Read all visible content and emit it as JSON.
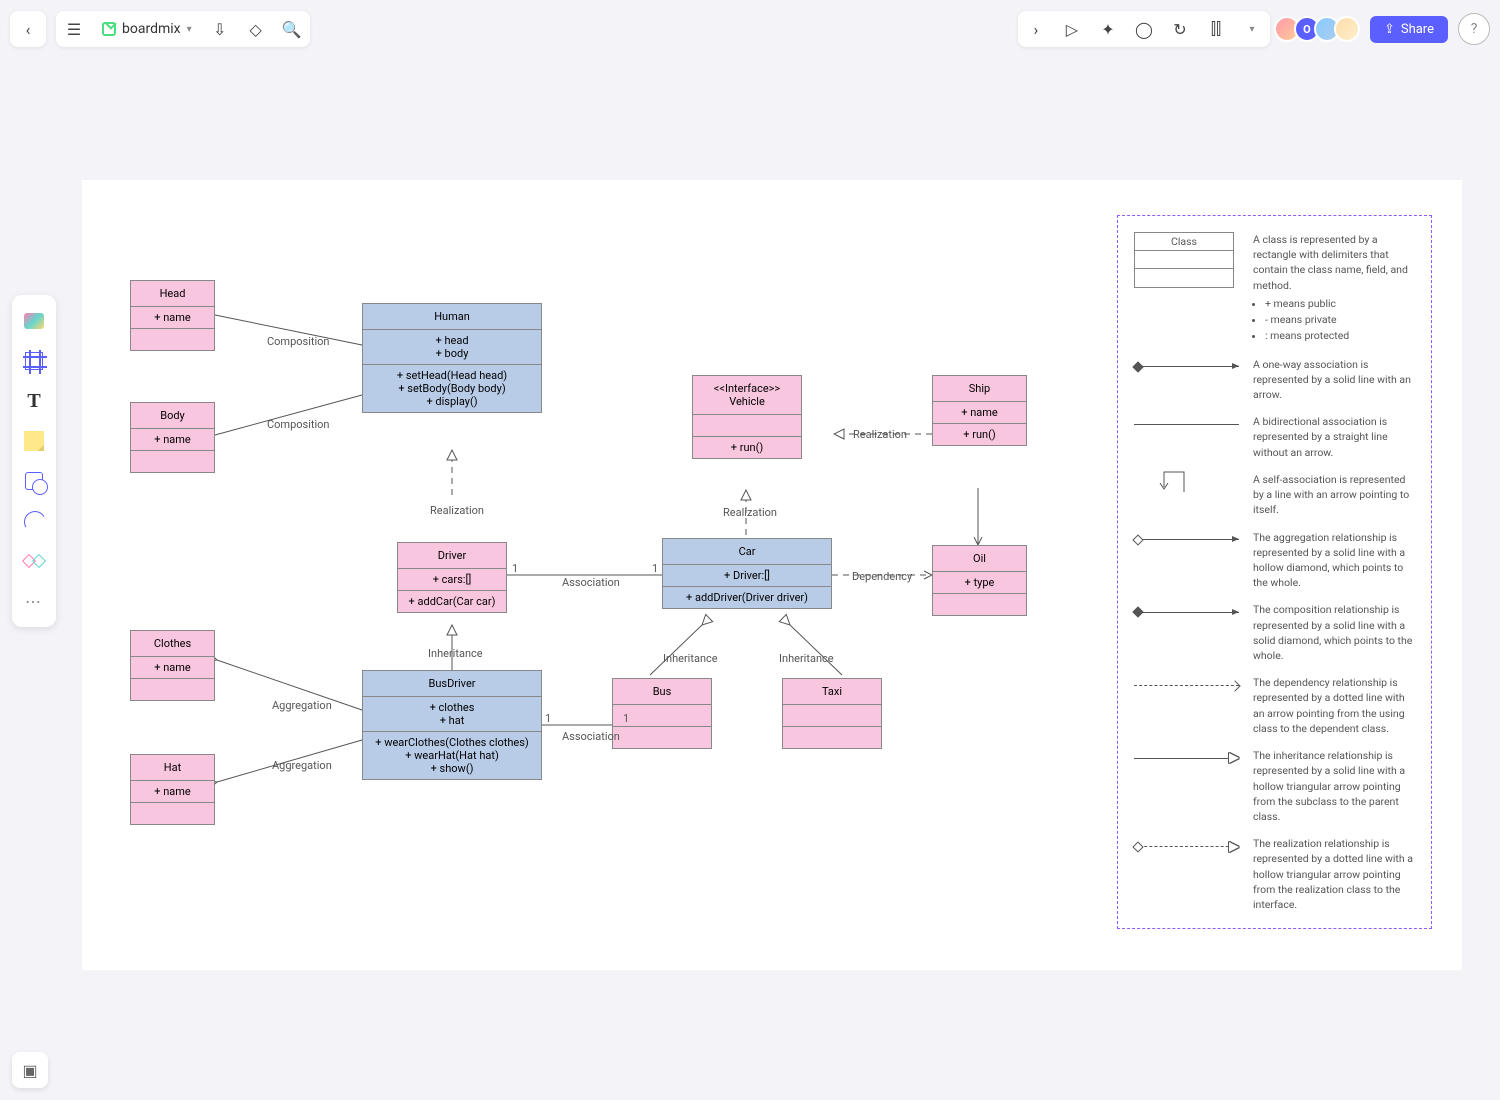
{
  "app": {
    "name": "boardmix"
  },
  "toolbar": {
    "share": "Share",
    "avatar_letter": "O"
  },
  "classes": {
    "head": {
      "name": "Head",
      "attrs": [
        "+ name"
      ]
    },
    "body": {
      "name": "Body",
      "attrs": [
        "+ name"
      ]
    },
    "human": {
      "name": "Human",
      "attrs": [
        "+ head",
        "+ body"
      ],
      "ops": [
        "+ setHead(Head head)",
        "+ setBody(Body body)",
        "+ display()"
      ]
    },
    "driver": {
      "name": "Driver",
      "attrs": [
        "+ cars:[]"
      ],
      "ops": [
        "+ addCar(Car car)"
      ]
    },
    "busdriver": {
      "name": "BusDriver",
      "attrs": [
        "+ clothes",
        "+ hat"
      ],
      "ops": [
        "+ wearClothes(Clothes clothes)",
        "+ wearHat(Hat hat)",
        "+ show()"
      ]
    },
    "clothes": {
      "name": "Clothes",
      "attrs": [
        "+ name"
      ]
    },
    "hat": {
      "name": "Hat",
      "attrs": [
        "+ name"
      ]
    },
    "vehicle": {
      "stereo": "<<Interface>>",
      "name": "Vehicle",
      "ops": [
        "+ run()"
      ]
    },
    "car": {
      "name": "Car",
      "attrs": [
        "+ Driver:[]"
      ],
      "ops": [
        "+ addDriver(Driver driver)"
      ]
    },
    "bus": {
      "name": "Bus"
    },
    "taxi": {
      "name": "Taxi"
    },
    "ship": {
      "name": "Ship",
      "attrs": [
        "+ name"
      ],
      "ops": [
        "+ run()"
      ]
    },
    "oil": {
      "name": "Oil",
      "attrs": [
        "+ type"
      ]
    }
  },
  "labels": {
    "composition": "Composition",
    "aggregation": "Aggregation",
    "realization": "Realization",
    "inheritance": "Inheritance",
    "association": "Association",
    "dependency": "Dependency",
    "one": "1"
  },
  "legend": {
    "class_title": "Class",
    "class_desc": "A class is represented by a rectangle with delimiters that contain the class name, field, and method.",
    "b1": "+ means public",
    "b2": "- means private",
    "b3": ": means protected",
    "assoc": "A one-way association is represented by a solid line with an arrow.",
    "biassoc": "A bidirectional association is represented by a straight line without an arrow.",
    "self": "A self-association is represented by a line with an arrow pointing to itself.",
    "agg": "The aggregation relationship is represented by a solid line with a hollow diamond, which points to the whole.",
    "comp": "The composition relationship is represented by a solid line with a solid diamond, which points to the whole.",
    "dep": "The dependency relationship is represented by a dotted line with an arrow pointing from the using class to the dependent class.",
    "inh": "The inheritance relationship is represented by a solid line with a hollow triangular arrow pointing from the subclass to the parent class.",
    "real": "The realization relationship is represented by a dotted line with a hollow triangular arrow pointing from the realization class to the interface."
  }
}
